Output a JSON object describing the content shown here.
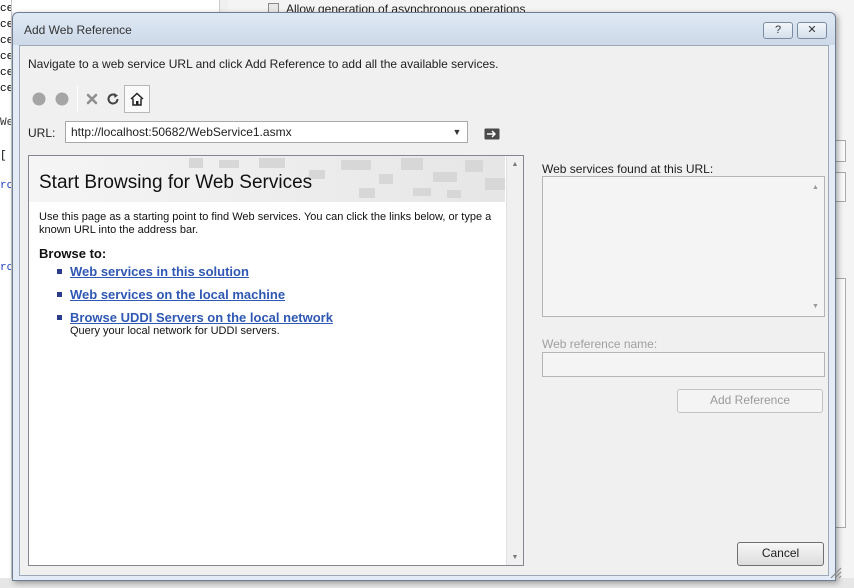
{
  "background": {
    "left_fragments": [
      "cem:",
      "ce",
      "ce",
      "ce",
      "ce",
      "ce",
      "We",
      "[",
      "ro",
      "ro"
    ],
    "top_checkbox_label": "Allow generation of asynchronous operations"
  },
  "dialog": {
    "title": "Add Web Reference",
    "help_label": "?",
    "close_label": "✕"
  },
  "instruction": "Navigate to a web service URL and click Add Reference to add all the available services.",
  "toolbar": {
    "icons": [
      "back-icon",
      "forward-icon",
      "stop-icon",
      "refresh-icon",
      "home-icon"
    ]
  },
  "url": {
    "label": "URL:",
    "value": "http://localhost:50682/WebService1.asmx"
  },
  "browser": {
    "title": "Start Browsing for Web Services",
    "description": "Use this page as a starting point to find Web services. You can click the links below, or type a known URL into the address bar.",
    "browse_to": "Browse to:",
    "links": [
      {
        "label": "Web services in this solution",
        "sub": ""
      },
      {
        "label": "Web services on the local machine",
        "sub": ""
      },
      {
        "label": "Browse UDDI Servers on the local network",
        "sub": "Query your local network for UDDI servers."
      }
    ]
  },
  "right_panel": {
    "found_label": "Web services found at this URL:",
    "ref_name_label": "Web reference name:",
    "ref_name_value": "",
    "add_reference_label": "Add Reference"
  },
  "cancel_label": "Cancel",
  "colors": {
    "link": "#2f58b4",
    "title_bar": "#dfe9f5",
    "disabled_text": "#9a9a9a"
  }
}
